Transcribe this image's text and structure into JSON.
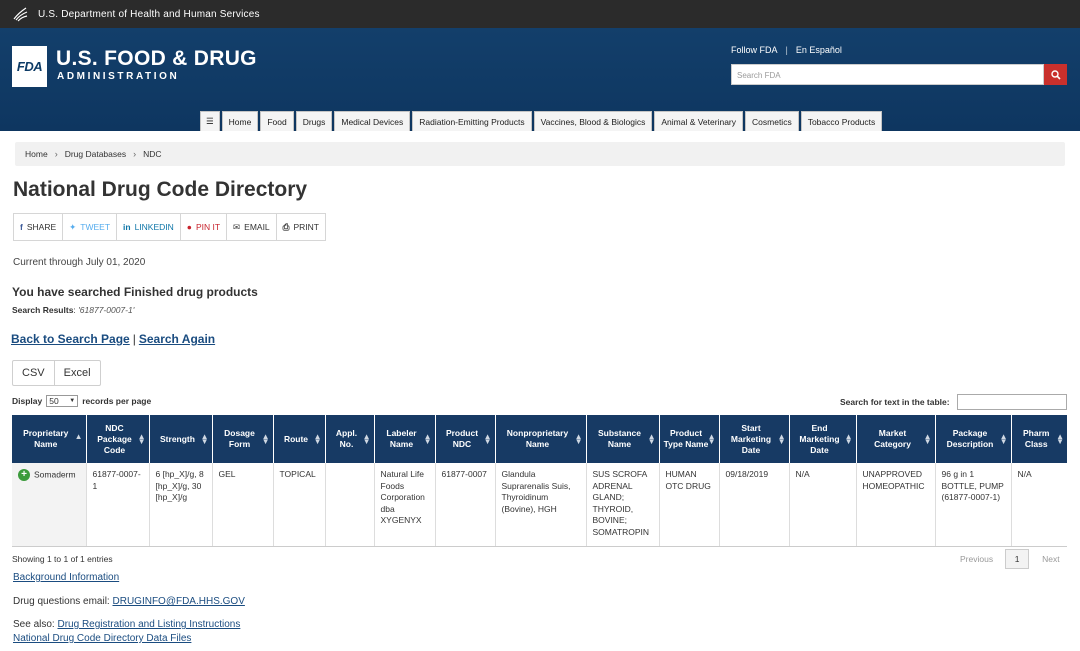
{
  "hhs_bar": {
    "text": "U.S. Department of Health and Human Services"
  },
  "header": {
    "badge": "FDA",
    "name": "U.S. FOOD & DRUG",
    "subname": "ADMINISTRATION",
    "follow": "Follow FDA",
    "espanol": "En Español",
    "search_placeholder": "Search FDA"
  },
  "nav": {
    "items": [
      "Home",
      "Food",
      "Drugs",
      "Medical Devices",
      "Radiation-Emitting Products",
      "Vaccines, Blood & Biologics",
      "Animal & Veterinary",
      "Cosmetics",
      "Tobacco Products"
    ]
  },
  "breadcrumb": [
    "Home",
    "Drug Databases",
    "NDC"
  ],
  "page_title": "National Drug Code Directory",
  "share": {
    "share": "SHARE",
    "tweet": "TWEET",
    "linkedin": "LINKEDIN",
    "pinit": "PIN IT",
    "email": "EMAIL",
    "print": "PRINT"
  },
  "current_through": "Current through July 01, 2020",
  "searched": "You have searched Finished drug products",
  "search_results_label": "Search Results",
  "search_results_value": "'61877-0007-1'",
  "back_link": "Back to Search Page",
  "again_link": "Search Again",
  "export": {
    "csv": "CSV",
    "excel": "Excel"
  },
  "display": {
    "prefix": "Display",
    "value": "50",
    "suffix": "records per page"
  },
  "table_search_label": "Search for text in the table:",
  "table": {
    "headers": [
      "Proprietary Name",
      "NDC Package Code",
      "Strength",
      "Dosage Form",
      "Route",
      "Appl. No.",
      "Labeler Name",
      "Product NDC",
      "Nonproprietary Name",
      "Substance Name",
      "Product Type Name",
      "Start Marketing Date",
      "End Marketing Date",
      "Market Category",
      "Package Description",
      "Pharm Class"
    ],
    "row": {
      "proprietary": "Somaderm",
      "ndc_package": "61877-0007-1",
      "strength": "6 [hp_X]/g, 8 [hp_X]/g, 30 [hp_X]/g",
      "dosage": "GEL",
      "route": "TOPICAL",
      "appl": "",
      "labeler": "Natural Life Foods Corporation dba XYGENYX",
      "product_ndc": "61877-0007",
      "nonproprietary": "Glandula Suprarenalis Suis, Thyroidinum (Bovine), HGH",
      "substance": "SUS SCROFA ADRENAL GLAND; THYROID, BOVINE; SOMATROPIN",
      "product_type": "HUMAN OTC DRUG",
      "start": "09/18/2019",
      "end": "N/A",
      "market": "UNAPPROVED HOMEOPATHIC",
      "package": "96 g in 1 BOTTLE, PUMP (61877-0007-1)",
      "pharm": "N/A"
    }
  },
  "showing": "Showing 1 to 1 of 1 entries",
  "pager": {
    "previous": "Previous",
    "page": "1",
    "next": "Next"
  },
  "background_info": "Background Information",
  "email_label": "Drug questions email:",
  "email_value": "DRUGINFO@FDA.HHS.GOV",
  "seealso_label": "See also:",
  "seealso_link": "Drug Registration and Listing Instructions",
  "datafiles_link": "National Drug Code Directory Data Files"
}
